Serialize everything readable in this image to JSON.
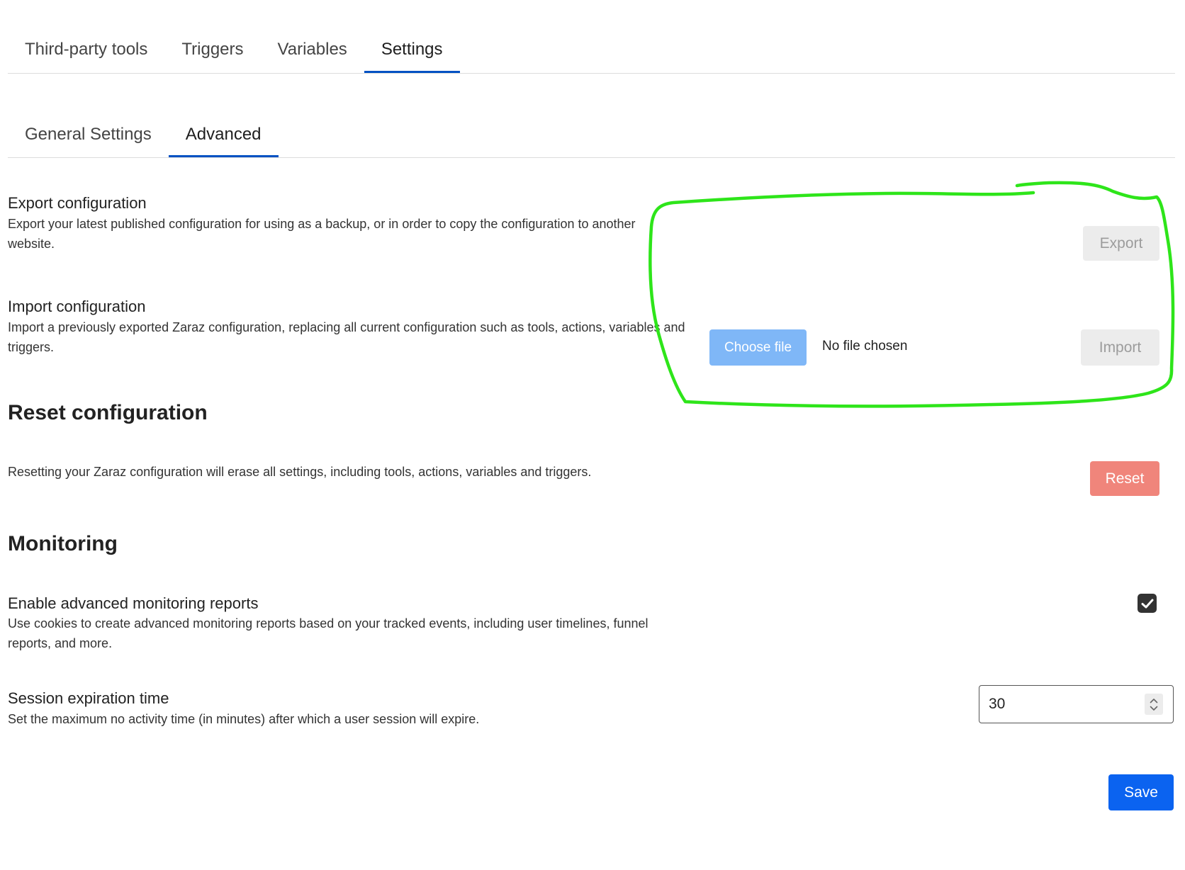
{
  "top_tabs": [
    {
      "label": "Third-party tools"
    },
    {
      "label": "Triggers"
    },
    {
      "label": "Variables"
    },
    {
      "label": "Settings"
    }
  ],
  "top_tabs_active_index": 3,
  "sub_tabs": [
    {
      "label": "General Settings"
    },
    {
      "label": "Advanced"
    }
  ],
  "sub_tabs_active_index": 1,
  "export": {
    "title": "Export configuration",
    "description": "Export your latest published configuration for using as a backup, or in order to copy the configuration to another website.",
    "button_label": "Export"
  },
  "import": {
    "title": "Import configuration",
    "description": "Import a previously exported Zaraz configuration, replacing all current configuration such as tools, actions, variables and triggers.",
    "choose_file_label": "Choose file",
    "file_status": "No file chosen",
    "button_label": "Import"
  },
  "reset": {
    "heading": "Reset configuration",
    "description": "Resetting your Zaraz configuration will erase all settings, including tools, actions, variables and triggers.",
    "button_label": "Reset"
  },
  "monitoring": {
    "heading": "Monitoring",
    "advanced_reports": {
      "title": "Enable advanced monitoring reports",
      "description": "Use cookies to create advanced monitoring reports based on your tracked events, including user timelines, funnel reports, and more.",
      "checked": true
    },
    "session_expiration": {
      "title": "Session expiration time",
      "description": "Set the maximum no activity time (in minutes) after which a user session will expire.",
      "value": "30"
    }
  },
  "save_label": "Save",
  "colors": {
    "tab_active_underline": "#0051c3",
    "annotation_stroke": "#2ee51a",
    "save_button": "#0b63f0",
    "reset_button": "#f0857b",
    "choose_file_button": "#7fb7f7"
  },
  "icons": {
    "checkbox": "check-icon",
    "spinner_up": "chevron-up-icon",
    "spinner_down": "chevron-down-icon"
  }
}
